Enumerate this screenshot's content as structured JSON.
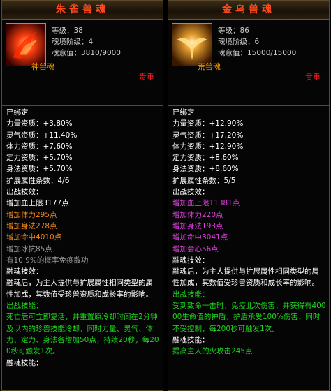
{
  "left": {
    "title": "朱雀兽魂",
    "level_label": "等级：",
    "level": "38",
    "stage_label": "魂境阶级：",
    "stage": "4",
    "soul_label": "魂意值：",
    "soul": "3810/9000",
    "kind": "神兽魂",
    "rarity": "贵重",
    "bound": "已绑定",
    "aptitudes": [
      {
        "label": "力量资质：",
        "value": "+3.80%"
      },
      {
        "label": "灵气资质：",
        "value": "+11.40%"
      },
      {
        "label": "体力资质：",
        "value": "+7.60%"
      },
      {
        "label": "定力资质：",
        "value": "+5.70%"
      },
      {
        "label": "身法资质：",
        "value": "+5.70%"
      },
      {
        "label": "扩展属性条数：",
        "value": "4/6"
      }
    ],
    "battle_title": "出战技效：",
    "effects": [
      {
        "text": "增加血上限3177点",
        "color": "w"
      },
      {
        "text": "增加体力295点",
        "color": "orange"
      },
      {
        "text": "增加身法278点",
        "color": "orange"
      },
      {
        "text": "增加命中4010点",
        "color": "orange"
      },
      {
        "text": "增加冰抗85点",
        "color": "gray"
      },
      {
        "text": "有10.9%的概率免疫散功",
        "color": "gray"
      }
    ],
    "fusion_title": "融魂技效：",
    "fusion_desc": "融魂后，为主人提供与扩展属性相同类型的属性加成，其数值受珍兽资质和成长率的影响。",
    "skill_title": "出战技能：",
    "skill_desc": "死亡后可立即复活，并重置原冷却时间在2分钟及以内的珍兽技能冷却，同时力量、灵气、体力、定力、身法各增加50点，持续20秒，每200秒可触发1次。",
    "fusion_skill_title": "融魂技能："
  },
  "right": {
    "title": "金乌兽魂",
    "level_label": "等级：",
    "level": "86",
    "stage_label": "魂境阶级：",
    "stage": "6",
    "soul_label": "魂意值：",
    "soul": "15000/15000",
    "kind": "荒兽魂",
    "rarity": "贵重",
    "bound": "已绑定",
    "aptitudes": [
      {
        "label": "力量资质：",
        "value": "+12.90%"
      },
      {
        "label": "灵气资质：",
        "value": "+17.20%"
      },
      {
        "label": "体力资质：",
        "value": "+12.90%"
      },
      {
        "label": "定力资质：",
        "value": "+8.60%"
      },
      {
        "label": "身法资质：",
        "value": "+8.60%"
      },
      {
        "label": "扩展属性条数：",
        "value": "5/5"
      }
    ],
    "battle_title": "出战技效：",
    "effects": [
      {
        "text": "增加血上限11381点",
        "color": "purple"
      },
      {
        "text": "增加体力220点",
        "color": "purple"
      },
      {
        "text": "增加身法193点",
        "color": "purple"
      },
      {
        "text": "增加命中3041点",
        "color": "purple"
      },
      {
        "text": "增加会心56点",
        "color": "purple"
      }
    ],
    "fusion_title": "融魂技效：",
    "fusion_desc": "融魂后，为主人提供与扩展属性相同类型的属性加成，其数值受珍兽资质和成长率的影响。",
    "skill_title": "出战技能：",
    "skill_desc": "受到致命一击时，免疫此次伤害，并获得有40000生命值的护盾，护盾承受100%伤害，同时不受控制，每200秒可触发1次。",
    "fusion_skill_title": "融魂技能：",
    "fusion_skill_desc": "提高主人的火攻击245点"
  },
  "colors": {
    "title": "#ff4a1e",
    "kind": "#f0a000",
    "rarity": "#ff1e1e",
    "orange": "#f08a1e",
    "purple": "#e040e0",
    "green": "#1ed41e",
    "border": "#5a4a2a"
  }
}
